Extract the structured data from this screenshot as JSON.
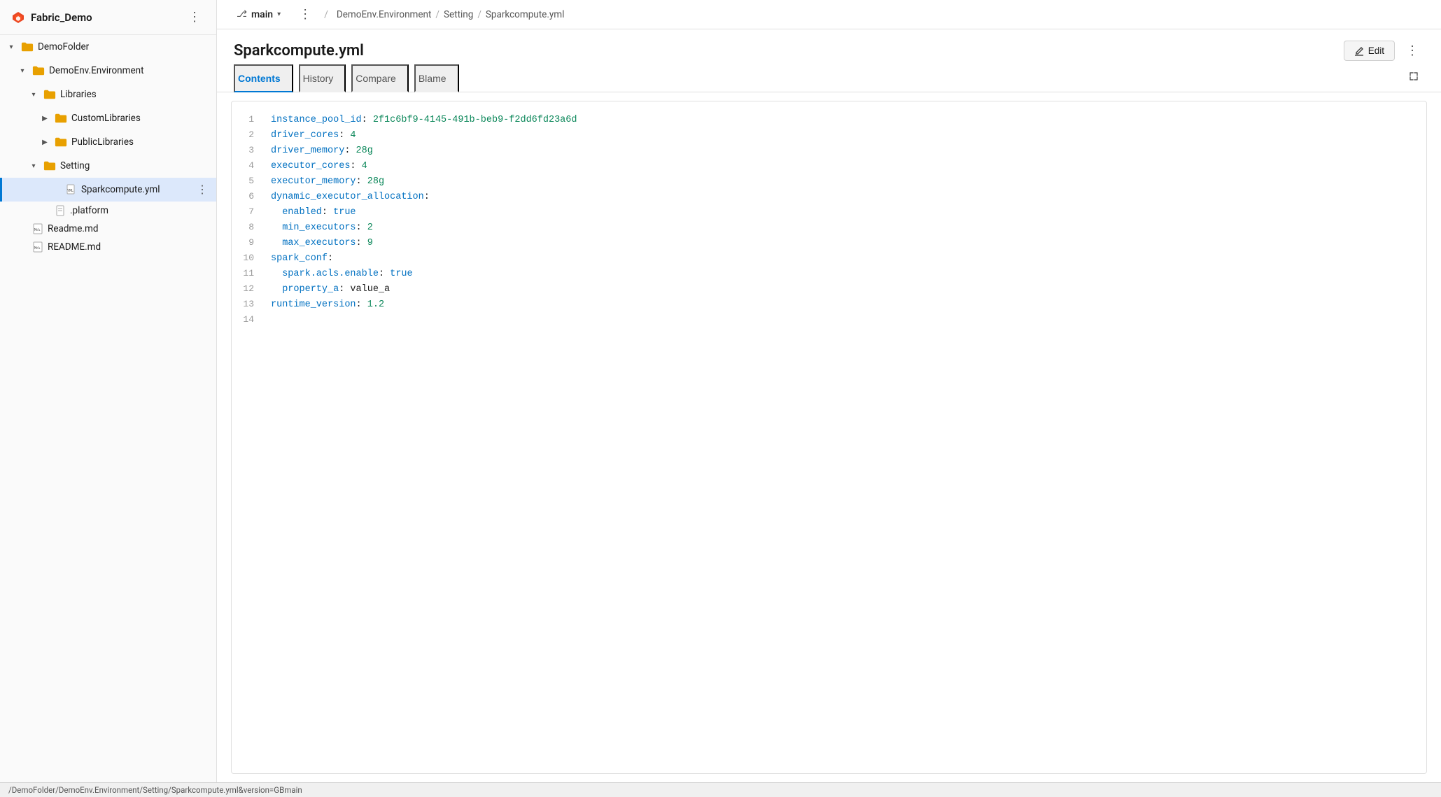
{
  "app": {
    "title": "Fabric_Demo",
    "more_btn_label": "⋮"
  },
  "sidebar": {
    "items": [
      {
        "id": "demofolder",
        "label": "DemoFolder",
        "type": "folder",
        "indent": 0,
        "expanded": true,
        "chevron": "▾"
      },
      {
        "id": "demoenv",
        "label": "DemoEnv.Environment",
        "type": "folder",
        "indent": 1,
        "expanded": true,
        "chevron": "▾"
      },
      {
        "id": "libraries",
        "label": "Libraries",
        "type": "folder",
        "indent": 2,
        "expanded": true,
        "chevron": "▾"
      },
      {
        "id": "customlibraries",
        "label": "CustomLibraries",
        "type": "folder",
        "indent": 3,
        "expanded": false,
        "chevron": "▶"
      },
      {
        "id": "publiclibraries",
        "label": "PublicLibraries",
        "type": "folder",
        "indent": 3,
        "expanded": false,
        "chevron": "▶"
      },
      {
        "id": "setting",
        "label": "Setting",
        "type": "folder",
        "indent": 2,
        "expanded": true,
        "chevron": "▾"
      },
      {
        "id": "sparkcompute",
        "label": "Sparkcompute.yml",
        "type": "yml-file",
        "indent": 4,
        "active": true
      },
      {
        "id": "platform",
        "label": ".platform",
        "type": "file",
        "indent": 3
      },
      {
        "id": "readme-md",
        "label": "Readme.md",
        "type": "md-file",
        "indent": 1
      },
      {
        "id": "readme-md2",
        "label": "README.md",
        "type": "md-file",
        "indent": 1
      }
    ]
  },
  "topbar": {
    "branch_icon": "⎇",
    "branch_name": "main",
    "more_label": "⋮",
    "breadcrumb": [
      {
        "label": "DemoEnv.Environment"
      },
      {
        "label": "Setting"
      },
      {
        "label": "Sparkcompute.yml"
      }
    ]
  },
  "file": {
    "title": "Sparkcompute.yml",
    "edit_label": "Edit",
    "more_label": "⋮",
    "tabs": [
      {
        "id": "contents",
        "label": "Contents",
        "active": true
      },
      {
        "id": "history",
        "label": "History",
        "active": false
      },
      {
        "id": "compare",
        "label": "Compare",
        "active": false
      },
      {
        "id": "blame",
        "label": "Blame",
        "active": false
      }
    ]
  },
  "code": {
    "lines": [
      {
        "num": "1",
        "content": "instance_pool_id: 2f1c6bf9-4145-491b-beb9-f2dd6fd23a6d",
        "type": "key-guid"
      },
      {
        "num": "2",
        "content": "driver_cores: 4",
        "type": "key-num"
      },
      {
        "num": "3",
        "content": "driver_memory: 28g",
        "type": "key-str"
      },
      {
        "num": "4",
        "content": "executor_cores: 4",
        "type": "key-num"
      },
      {
        "num": "5",
        "content": "executor_memory: 28g",
        "type": "key-str"
      },
      {
        "num": "6",
        "content": "dynamic_executor_allocation:",
        "type": "key-only"
      },
      {
        "num": "7",
        "content": "  enabled: true",
        "type": "indented-key-bool",
        "indent": true
      },
      {
        "num": "8",
        "content": "  min_executors: 2",
        "type": "indented-key-num",
        "indent": true
      },
      {
        "num": "9",
        "content": "  max_executors: 9",
        "type": "indented-key-num",
        "indent": true
      },
      {
        "num": "10",
        "content": "spark_conf:",
        "type": "key-only"
      },
      {
        "num": "11",
        "content": "  spark.acls.enable: true",
        "type": "indented-key-bool",
        "indent": true
      },
      {
        "num": "12",
        "content": "  property_a: value_a",
        "type": "indented-key-str",
        "indent": true
      },
      {
        "num": "13",
        "content": "runtime_version: 1.2",
        "type": "key-num"
      },
      {
        "num": "14",
        "content": "",
        "type": "empty"
      }
    ]
  },
  "statusbar": {
    "path": "/DemoFolder/DemoEnv.Environment/Setting/Sparkcompute.yml&version=GBmain"
  }
}
